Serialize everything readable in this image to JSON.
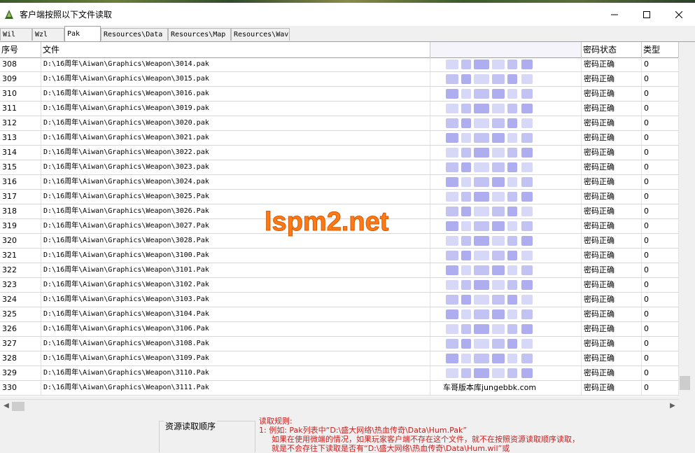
{
  "window": {
    "title": "客户端按照以下文件读取",
    "controls": [
      "minimize-icon",
      "maximize-icon",
      "close-icon"
    ]
  },
  "tabs": [
    {
      "label": "Wil",
      "active": false
    },
    {
      "label": "Wzl",
      "active": false
    },
    {
      "label": "Pak",
      "active": true
    },
    {
      "label": "Resources\\Data",
      "active": false
    },
    {
      "label": "Resources\\Map",
      "active": false
    },
    {
      "label": "Resources\\Wav",
      "active": false
    }
  ],
  "table": {
    "columns": [
      "序号",
      "文件",
      "",
      "密码状态",
      "类型"
    ],
    "rows": [
      {
        "num": "308",
        "file": "D:\\16周年\\Aiwan\\Graphics\\Weapon\\3014.pak",
        "blur_text": "",
        "status": "密码正确",
        "type": "0"
      },
      {
        "num": "309",
        "file": "D:\\16周年\\Aiwan\\Graphics\\Weapon\\3015.pak",
        "blur_text": "",
        "status": "密码正确",
        "type": "0"
      },
      {
        "num": "310",
        "file": "D:\\16周年\\Aiwan\\Graphics\\Weapon\\3016.pak",
        "blur_text": "",
        "status": "密码正确",
        "type": "0"
      },
      {
        "num": "311",
        "file": "D:\\16周年\\Aiwan\\Graphics\\Weapon\\3019.pak",
        "blur_text": "",
        "status": "密码正确",
        "type": "0"
      },
      {
        "num": "312",
        "file": "D:\\16周年\\Aiwan\\Graphics\\Weapon\\3020.pak",
        "blur_text": "",
        "status": "密码正确",
        "type": "0"
      },
      {
        "num": "313",
        "file": "D:\\16周年\\Aiwan\\Graphics\\Weapon\\3021.pak",
        "blur_text": "",
        "status": "密码正确",
        "type": "0"
      },
      {
        "num": "314",
        "file": "D:\\16周年\\Aiwan\\Graphics\\Weapon\\3022.pak",
        "blur_text": "",
        "status": "密码正确",
        "type": "0"
      },
      {
        "num": "315",
        "file": "D:\\16周年\\Aiwan\\Graphics\\Weapon\\3023.pak",
        "blur_text": "",
        "status": "密码正确",
        "type": "0"
      },
      {
        "num": "316",
        "file": "D:\\16周年\\Aiwan\\Graphics\\Weapon\\3024.pak",
        "blur_text": "",
        "status": "密码正确",
        "type": "0"
      },
      {
        "num": "317",
        "file": "D:\\16周年\\Aiwan\\Graphics\\Weapon\\3025.Pak",
        "blur_text": "",
        "status": "密码正确",
        "type": "0"
      },
      {
        "num": "318",
        "file": "D:\\16周年\\Aiwan\\Graphics\\Weapon\\3026.Pak",
        "blur_text": "",
        "status": "密码正确",
        "type": "0"
      },
      {
        "num": "319",
        "file": "D:\\16周年\\Aiwan\\Graphics\\Weapon\\3027.Pak",
        "blur_text": "",
        "status": "密码正确",
        "type": "0"
      },
      {
        "num": "320",
        "file": "D:\\16周年\\Aiwan\\Graphics\\Weapon\\3028.Pak",
        "blur_text": "",
        "status": "密码正确",
        "type": "0"
      },
      {
        "num": "321",
        "file": "D:\\16周年\\Aiwan\\Graphics\\Weapon\\3100.Pak",
        "blur_text": "",
        "status": "密码正确",
        "type": "0"
      },
      {
        "num": "322",
        "file": "D:\\16周年\\Aiwan\\Graphics\\Weapon\\3101.Pak",
        "blur_text": "",
        "status": "密码正确",
        "type": "0"
      },
      {
        "num": "323",
        "file": "D:\\16周年\\Aiwan\\Graphics\\Weapon\\3102.Pak",
        "blur_text": "",
        "status": "密码正确",
        "type": "0"
      },
      {
        "num": "324",
        "file": "D:\\16周年\\Aiwan\\Graphics\\Weapon\\3103.Pak",
        "blur_text": "",
        "status": "密码正确",
        "type": "0"
      },
      {
        "num": "325",
        "file": "D:\\16周年\\Aiwan\\Graphics\\Weapon\\3104.Pak",
        "blur_text": "",
        "status": "密码正确",
        "type": "0"
      },
      {
        "num": "326",
        "file": "D:\\16周年\\Aiwan\\Graphics\\Weapon\\3106.Pak",
        "blur_text": "",
        "status": "密码正确",
        "type": "0"
      },
      {
        "num": "327",
        "file": "D:\\16周年\\Aiwan\\Graphics\\Weapon\\3108.Pak",
        "blur_text": "",
        "status": "密码正确",
        "type": "0"
      },
      {
        "num": "328",
        "file": "D:\\16周年\\Aiwan\\Graphics\\Weapon\\3109.Pak",
        "blur_text": "",
        "status": "密码正确",
        "type": "0"
      },
      {
        "num": "329",
        "file": "D:\\16周年\\Aiwan\\Graphics\\Weapon\\3110.Pak",
        "blur_text": "",
        "status": "密码正确",
        "type": "0"
      },
      {
        "num": "330",
        "file": "D:\\16周年\\Aiwan\\Graphics\\Weapon\\3111.Pak",
        "blur_text": "车哥版本库jungebbk.com",
        "status": "密码正确",
        "type": "0"
      }
    ]
  },
  "watermark": "lspm2.net",
  "bottom": {
    "group_label": "资源读取顺序",
    "rules_title": "读取规则:",
    "rules_lines": [
      "1: 例如: Pak列表中“D:\\盛大网络\\热血传奇\\Data\\Hum.Pak”",
      "如果在使用微端的情况，如果玩家客户端不存在这个文件，就不在按照资源读取顺序读取，",
      "就是不会存往下读取是否有“D:\\盛大网络\\热血传奇\\Data\\Hum.wil”或"
    ]
  },
  "colors": {
    "blur_fill": "#8c8ce8",
    "watermark": "#ff7a16",
    "rules_text": "#cc2020"
  }
}
